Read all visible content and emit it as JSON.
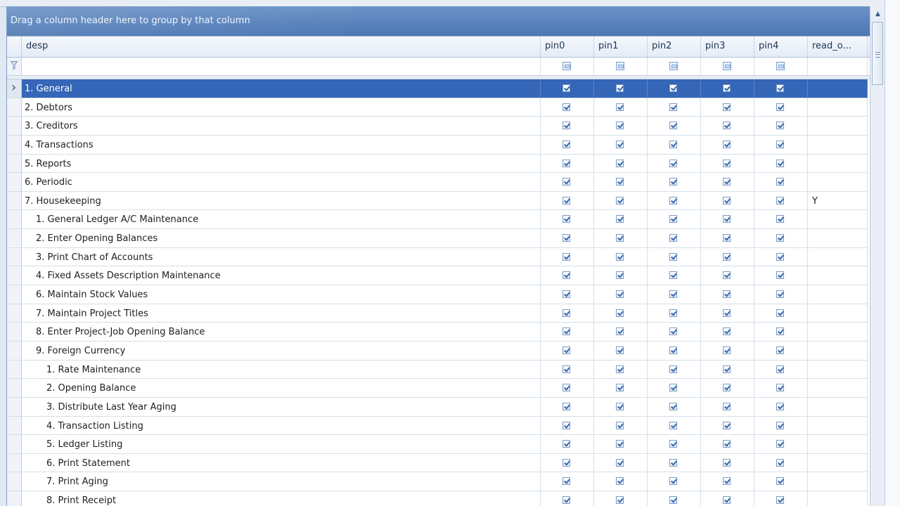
{
  "group_panel": {
    "text": "Drag a column header here to group by that column"
  },
  "columns": {
    "desp": "desp",
    "pin0": "pin0",
    "pin1": "pin1",
    "pin2": "pin2",
    "pin3": "pin3",
    "pin4": "pin4",
    "read_only": "read_o..."
  },
  "rows": [
    {
      "desp": "1. General",
      "pin0": true,
      "pin1": true,
      "pin2": true,
      "pin3": true,
      "pin4": true,
      "read_only": "",
      "level": 0,
      "selected": true
    },
    {
      "desp": "2. Debtors",
      "pin0": true,
      "pin1": true,
      "pin2": true,
      "pin3": true,
      "pin4": true,
      "read_only": "",
      "level": 0
    },
    {
      "desp": "3. Creditors",
      "pin0": true,
      "pin1": true,
      "pin2": true,
      "pin3": true,
      "pin4": true,
      "read_only": "",
      "level": 0
    },
    {
      "desp": "4. Transactions",
      "pin0": true,
      "pin1": true,
      "pin2": true,
      "pin3": true,
      "pin4": true,
      "read_only": "",
      "level": 0
    },
    {
      "desp": "5. Reports",
      "pin0": true,
      "pin1": true,
      "pin2": true,
      "pin3": true,
      "pin4": true,
      "read_only": "",
      "level": 0
    },
    {
      "desp": "6. Periodic",
      "pin0": true,
      "pin1": true,
      "pin2": true,
      "pin3": true,
      "pin4": true,
      "read_only": "",
      "level": 0
    },
    {
      "desp": "7. Housekeeping",
      "pin0": true,
      "pin1": true,
      "pin2": true,
      "pin3": true,
      "pin4": true,
      "read_only": "Y",
      "level": 0
    },
    {
      "desp": "1. General Ledger A/C Maintenance",
      "pin0": true,
      "pin1": true,
      "pin2": true,
      "pin3": true,
      "pin4": true,
      "read_only": "",
      "level": 1
    },
    {
      "desp": "2. Enter Opening Balances",
      "pin0": true,
      "pin1": true,
      "pin2": true,
      "pin3": true,
      "pin4": true,
      "read_only": "",
      "level": 1
    },
    {
      "desp": "3. Print Chart of Accounts",
      "pin0": true,
      "pin1": true,
      "pin2": true,
      "pin3": true,
      "pin4": true,
      "read_only": "",
      "level": 1
    },
    {
      "desp": "4. Fixed Assets Description Maintenance",
      "pin0": true,
      "pin1": true,
      "pin2": true,
      "pin3": true,
      "pin4": true,
      "read_only": "",
      "level": 1
    },
    {
      "desp": "6. Maintain Stock Values",
      "pin0": true,
      "pin1": true,
      "pin2": true,
      "pin3": true,
      "pin4": true,
      "read_only": "",
      "level": 1
    },
    {
      "desp": "7. Maintain Project Titles",
      "pin0": true,
      "pin1": true,
      "pin2": true,
      "pin3": true,
      "pin4": true,
      "read_only": "",
      "level": 1
    },
    {
      "desp": "8. Enter Project-Job Opening Balance",
      "pin0": true,
      "pin1": true,
      "pin2": true,
      "pin3": true,
      "pin4": true,
      "read_only": "",
      "level": 1
    },
    {
      "desp": "9. Foreign Currency",
      "pin0": true,
      "pin1": true,
      "pin2": true,
      "pin3": true,
      "pin4": true,
      "read_only": "",
      "level": 1
    },
    {
      "desp": "1. Rate Maintenance",
      "pin0": true,
      "pin1": true,
      "pin2": true,
      "pin3": true,
      "pin4": true,
      "read_only": "",
      "level": 2
    },
    {
      "desp": "2. Opening Balance",
      "pin0": true,
      "pin1": true,
      "pin2": true,
      "pin3": true,
      "pin4": true,
      "read_only": "",
      "level": 2
    },
    {
      "desp": "3. Distribute Last Year Aging",
      "pin0": true,
      "pin1": true,
      "pin2": true,
      "pin3": true,
      "pin4": true,
      "read_only": "",
      "level": 2
    },
    {
      "desp": "4. Transaction Listing",
      "pin0": true,
      "pin1": true,
      "pin2": true,
      "pin3": true,
      "pin4": true,
      "read_only": "",
      "level": 2
    },
    {
      "desp": "5. Ledger Listing",
      "pin0": true,
      "pin1": true,
      "pin2": true,
      "pin3": true,
      "pin4": true,
      "read_only": "",
      "level": 2
    },
    {
      "desp": "6. Print Statement",
      "pin0": true,
      "pin1": true,
      "pin2": true,
      "pin3": true,
      "pin4": true,
      "read_only": "",
      "level": 2
    },
    {
      "desp": "7. Print Aging",
      "pin0": true,
      "pin1": true,
      "pin2": true,
      "pin3": true,
      "pin4": true,
      "read_only": "",
      "level": 2
    },
    {
      "desp": "8. Print Receipt",
      "pin0": true,
      "pin1": true,
      "pin2": true,
      "pin3": true,
      "pin4": true,
      "read_only": "",
      "level": 2
    }
  ],
  "icons": {
    "row_indicator": "chevron-right-icon",
    "filter": "filter-icon",
    "scroll_up": "scroll-up-arrow-icon",
    "scroll_grip": "scroll-grip-icon"
  },
  "colors": {
    "selection": "#3566b7",
    "group_panel": "#5a83bd",
    "grid_line": "#d5dfeb"
  }
}
